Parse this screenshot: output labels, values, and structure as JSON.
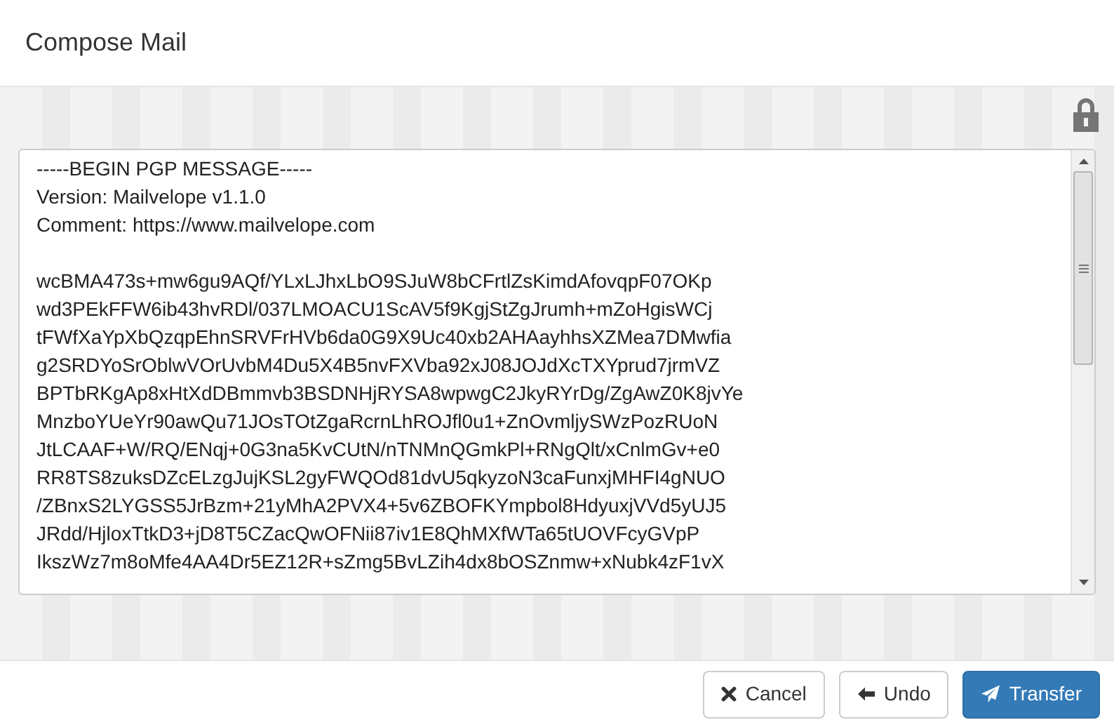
{
  "dialog": {
    "title": "Compose Mail"
  },
  "editor": {
    "header_lines": [
      "-----BEGIN PGP MESSAGE-----",
      "Version: Mailvelope v1.1.0",
      "Comment: https://www.mailvelope.com"
    ],
    "body_lines": [
      "wcBMA473s+mw6gu9AQf/YLxLJhxLbO9SJuW8bCFrtlZsKimdAfovqpF07OKp",
      "wd3PEkFFW6ib43hvRDl/037LMOACU1ScAV5f9KgjStZgJrumh+mZoHgisWCj",
      "tFWfXaYpXbQzqpEhnSRVFrHVb6da0G9X9Uc40xb2AHAayhhsXZMea7DMwfia",
      "g2SRDYoSrOblwVOrUvbM4Du5X4B5nvFXVba92xJ08JOJdXcTXYprud7jrmVZ",
      "BPTbRKgAp8xHtXdDBmmvb3BSDNHjRYSA8wpwgC2JkyRYrDg/ZgAwZ0K8jvYe",
      "MnzboYUeYr90awQu71JOsTOtZgaRcrnLhROJfl0u1+ZnOvmljySWzPozRUoN",
      "JtLCAAF+W/RQ/ENqj+0G3na5KvCUtN/nTNMnQGmkPl+RNgQlt/xCnlmGv+e0",
      "RR8TS8zuksDZcELzgJujKSL2gyFWQOd81dvU5qkyzoN3caFunxjMHFI4gNUO",
      "/ZBnxS2LYGSS5JrBzm+21yMhA2PVX4+5v6ZBOFKYmpbol8HdyuxjVVd5yUJ5",
      "JRdd/HjloxTtkD3+jD8T5CZacQwOFNii87iv1E8QhMXfWTa65tUOVFcyGVpP",
      "IkszWz7m8oMfe4AA4Dr5EZ12R+sZmg5BvLZih4dx8bOSZnmw+xNubk4zF1vX"
    ]
  },
  "buttons": [
    {
      "kind": "cancel",
      "label": "Cancel"
    },
    {
      "kind": "undo",
      "label": "Undo"
    },
    {
      "kind": "transfer",
      "label": "Transfer"
    }
  ]
}
